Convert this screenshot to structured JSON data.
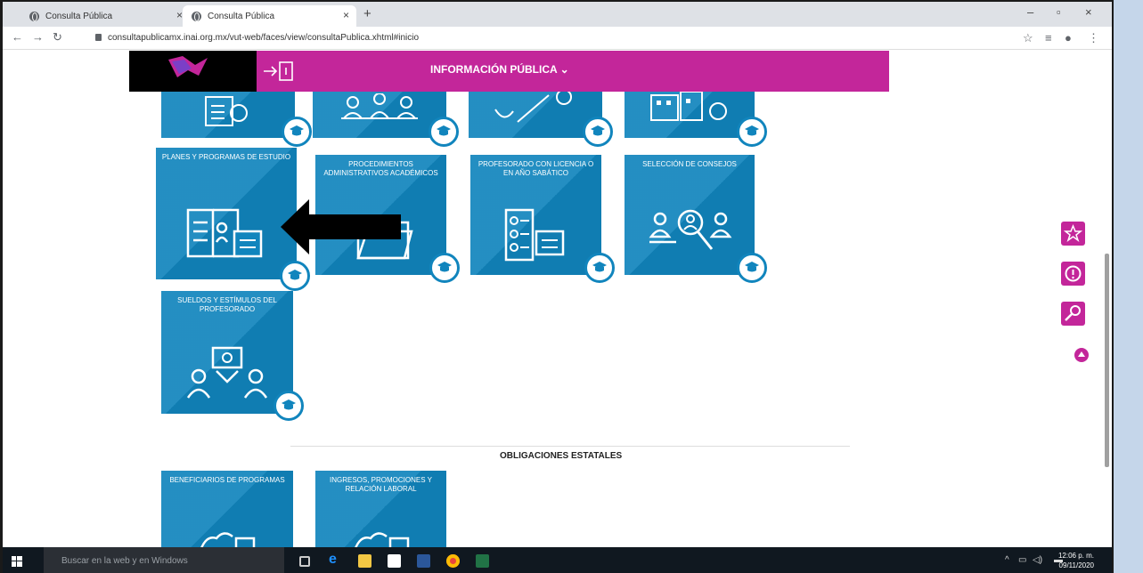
{
  "browser": {
    "tabs": [
      {
        "title": "Consulta Pública",
        "close": "×"
      },
      {
        "title": "Consulta Pública",
        "close": "×"
      }
    ],
    "new_tab": "+",
    "window_controls": {
      "minimize": "–",
      "restore": "▫",
      "close": "×"
    },
    "url": "consultapublicamx.inai.org.mx/vut-web/faces/view/consultaPublica.xhtml#inicio"
  },
  "header": {
    "title": "INFORMACIÓN PÚBLICA",
    "menu_chevron": "chevron-down-icon",
    "accent": "#c3269a"
  },
  "tiles": [
    {
      "label": "PLANES Y PROGRAMAS DE ESTUDIO",
      "icon": "book-calendar-icon"
    },
    {
      "label": "PROCEDIMIENTOS ADMINISTRATIVOS ACADÉMICOS",
      "icon": "folder-icon"
    },
    {
      "label": "PROFESORADO CON LICENCIA O EN AÑO SABÁTICO",
      "icon": "roster-calendar-icon"
    },
    {
      "label": "SELECCIÓN DE CONSEJOS",
      "icon": "people-search-icon"
    },
    {
      "label": "SUELDOS Y ESTÍMULOS DEL PROFESORADO",
      "icon": "salary-people-icon"
    }
  ],
  "top_tiles_icons": [
    "invoice-icon",
    "meeting-icon",
    "approval-icon",
    "building-icon"
  ],
  "section": {
    "title": "OBLIGACIONES ESTATALES"
  },
  "state_tiles": [
    {
      "label": "BENEFICIARIOS DE PROGRAMAS",
      "icon": "map-icon"
    },
    {
      "label": "INGRESOS, PROMOCIONES Y RELACIÓN LABORAL",
      "icon": "map-icon"
    }
  ],
  "tile_color": "#1185bd",
  "side_buttons": [
    "star-icon",
    "alert-icon",
    "tool-icon"
  ],
  "taskbar": {
    "search_placeholder": "Buscar en la web y en Windows",
    "time": "12:06 p. m.",
    "date": "09/11/2020"
  }
}
